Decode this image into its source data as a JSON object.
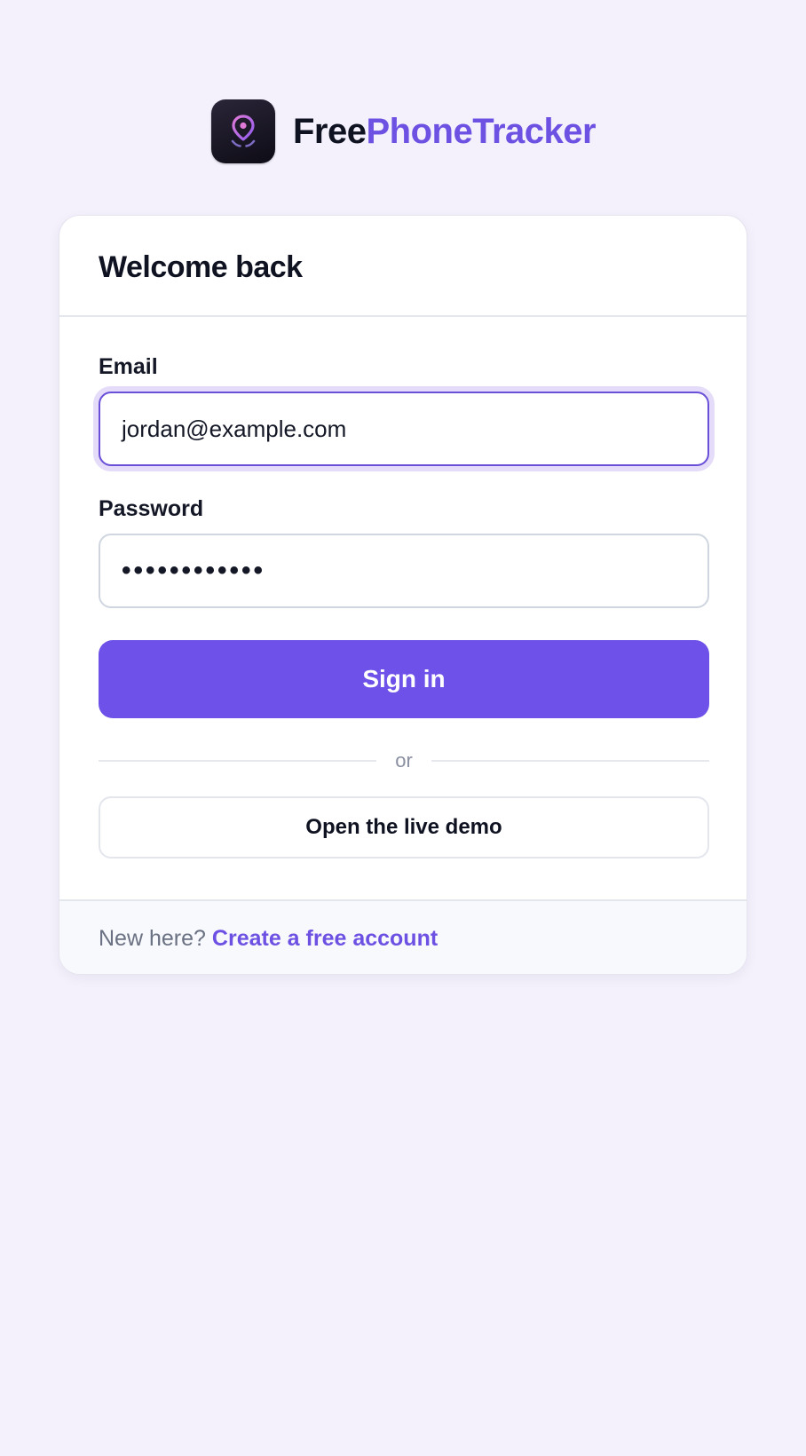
{
  "brand": {
    "name_part1": "Free",
    "name_part2": "PhoneTracker",
    "logo_icon": "location-pin-icon",
    "accent_color": "#6d51e3"
  },
  "card": {
    "title": "Welcome back"
  },
  "form": {
    "email_label": "Email",
    "email_value": "jordan@example.com",
    "password_label": "Password",
    "password_value": "••••••••••••",
    "sign_in_label": "Sign in",
    "divider_text": "or",
    "demo_label": "Open the live demo"
  },
  "footer": {
    "prompt": "New here?",
    "link_label": "Create a free account"
  }
}
